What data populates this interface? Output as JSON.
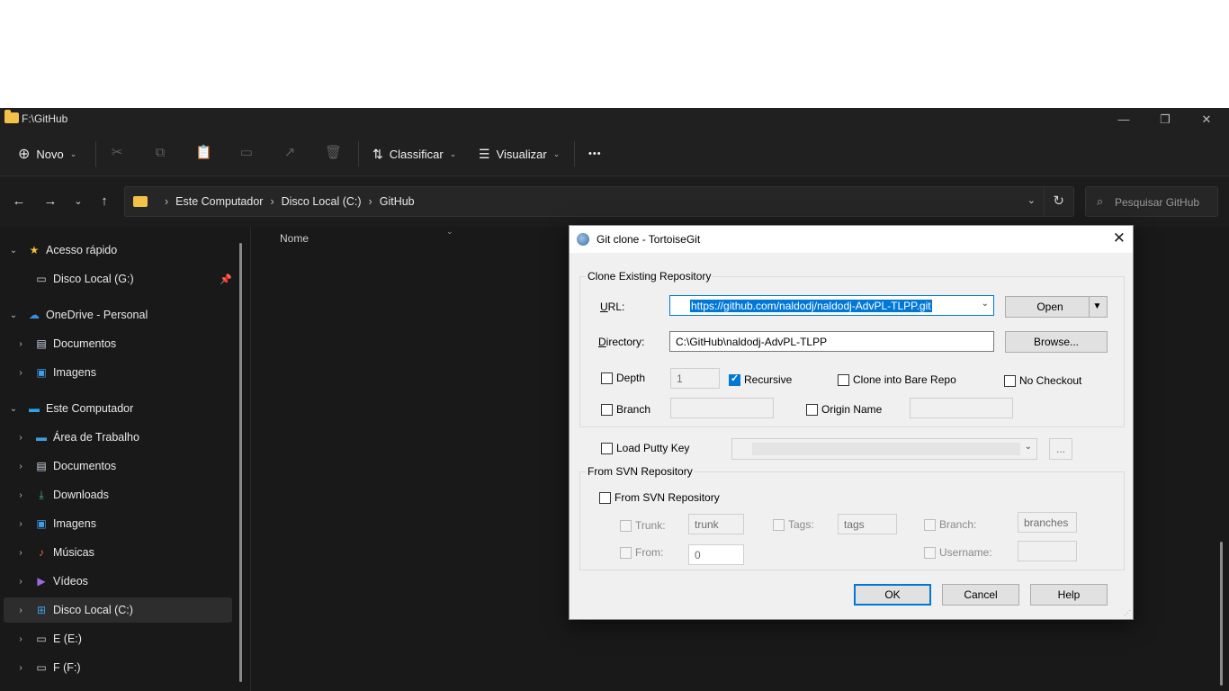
{
  "explorer": {
    "window_title": "F:\\GitHub",
    "window_controls": {
      "minimize": "—",
      "restore": "❐",
      "close": "✕"
    },
    "toolbar": {
      "new_label": "Novo",
      "sort_label": "Classificar",
      "view_label": "Visualizar",
      "more_label": "•••"
    },
    "address": {
      "crumbs": [
        "Este Computador",
        "Disco Local (C:)",
        "GitHub"
      ]
    },
    "search_placeholder": "Pesquisar GitHub",
    "sidebar": [
      {
        "label": "Acesso rápido",
        "level": 0,
        "icon": "star-icon"
      },
      {
        "label": "Disco Local (G:)",
        "level": 1,
        "icon": "drive-icon",
        "pinned": true
      },
      {
        "label": "OneDrive - Personal",
        "level": 0,
        "icon": "cloud-icon"
      },
      {
        "label": "Documentos",
        "level": 1,
        "icon": "document-icon"
      },
      {
        "label": "Imagens",
        "level": 1,
        "icon": "image-icon"
      },
      {
        "label": "Este Computador",
        "level": 0,
        "icon": "computer-icon"
      },
      {
        "label": "Área de Trabalho",
        "level": 1,
        "icon": "desktop-icon"
      },
      {
        "label": "Documentos",
        "level": 1,
        "icon": "document-icon"
      },
      {
        "label": "Downloads",
        "level": 1,
        "icon": "download-icon"
      },
      {
        "label": "Imagens",
        "level": 1,
        "icon": "image-icon"
      },
      {
        "label": "Músicas",
        "level": 1,
        "icon": "music-icon"
      },
      {
        "label": "Vídeos",
        "level": 1,
        "icon": "video-icon"
      },
      {
        "label": "Disco Local (C:)",
        "level": 1,
        "icon": "windows-drive-icon",
        "selected": true
      },
      {
        "label": "E (E:)",
        "level": 1,
        "icon": "drive-icon"
      },
      {
        "label": "F (F:)",
        "level": 1,
        "icon": "drive-icon"
      }
    ],
    "column_name": "Nome"
  },
  "dialog": {
    "title": "Git clone - TortoiseGit",
    "clone_group_label": "Clone Existing Repository",
    "url_label": "URL:",
    "url_value": "https://github.com/naldodj/naldodj-AdvPL-TLPP.git",
    "open_button": "Open",
    "directory_label": "Directory:",
    "directory_value": "C:\\GitHub\\naldodj-AdvPL-TLPP",
    "browse_button": "Browse...",
    "depth_label": "Depth",
    "depth_value": "1",
    "recursive_label": "Recursive",
    "bare_label": "Clone into Bare Repo",
    "nocheckout_label": "No Checkout",
    "branch_label": "Branch",
    "origin_label": "Origin Name",
    "putty_label": "Load Putty Key",
    "putty_browse": "...",
    "svn_group_label": "From SVN Repository",
    "svn_check_label": "From SVN Repository",
    "trunk_label": "Trunk:",
    "trunk_value": "trunk",
    "tags_label": "Tags:",
    "tags_value": "tags",
    "svn_branch_label": "Branch:",
    "svn_branch_value": "branches",
    "from_label": "From:",
    "from_value": "0",
    "username_label": "Username:",
    "ok_button": "OK",
    "cancel_button": "Cancel",
    "help_button": "Help",
    "checked": {
      "depth": false,
      "recursive": true,
      "bare": false,
      "nocheckout": false,
      "branch": false,
      "origin": false,
      "putty": false,
      "svn": false
    }
  },
  "colors": {
    "selection": "#0078d7",
    "explorer_bg": "#191919",
    "dialog_bg": "#f0f0f0"
  }
}
